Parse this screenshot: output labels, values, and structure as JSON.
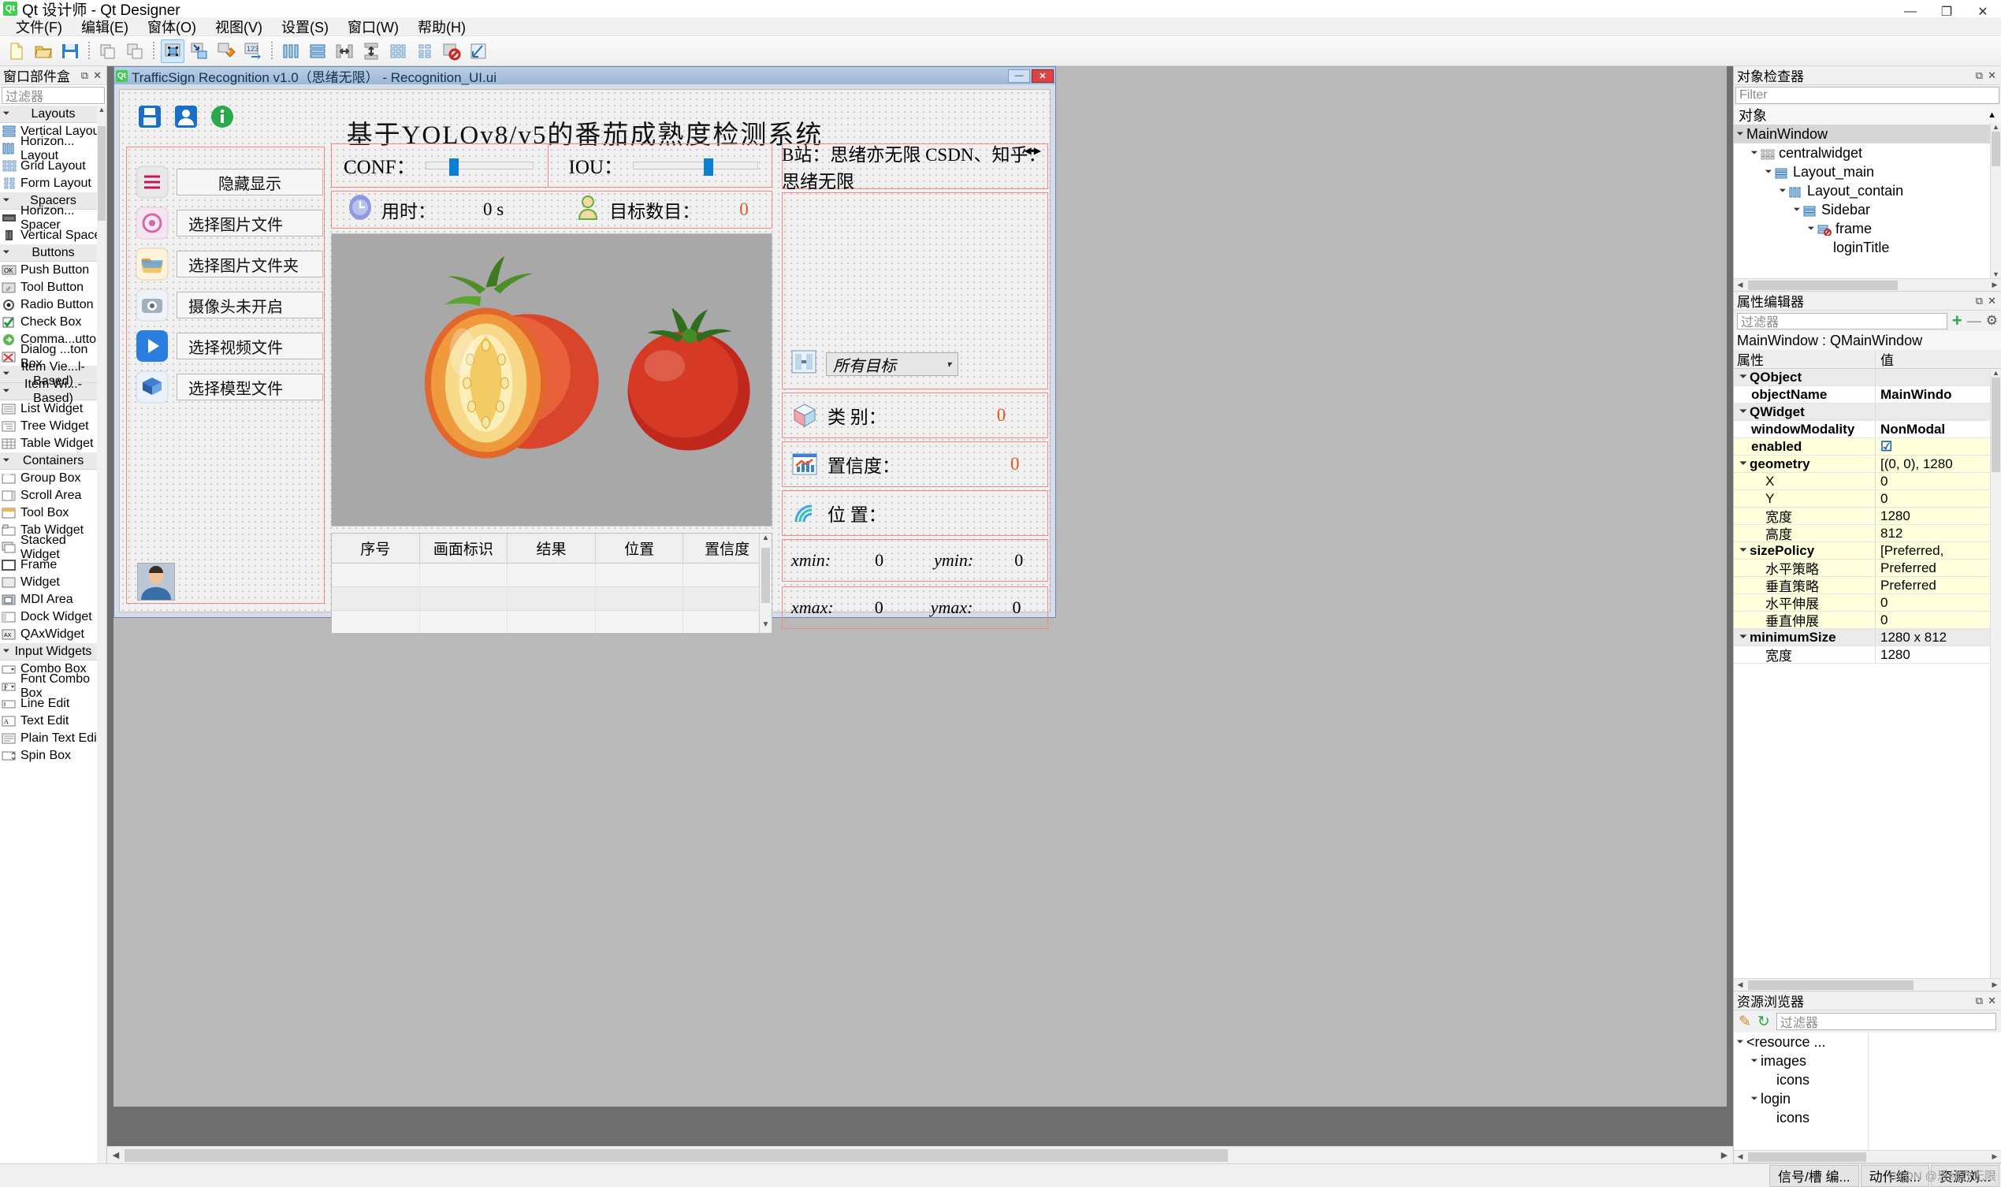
{
  "app": {
    "title": "Qt 设计师 - Qt Designer",
    "logo_text": "Qt",
    "win_buttons": {
      "minimize": "—",
      "maximize": "❐",
      "close": "✕"
    }
  },
  "menubar": {
    "items": [
      {
        "label": "文件(F)"
      },
      {
        "label": "编辑(E)"
      },
      {
        "label": "窗体(O)"
      },
      {
        "label": "视图(V)"
      },
      {
        "label": "设置(S)"
      },
      {
        "label": "窗口(W)"
      },
      {
        "label": "帮助(H)"
      }
    ]
  },
  "toolbar": {
    "buttons": [
      {
        "name": "new-form-icon"
      },
      {
        "name": "open-form-icon"
      },
      {
        "name": "save-form-icon"
      },
      {
        "name": "cut-icon"
      },
      {
        "name": "copy-icon"
      },
      {
        "name": "edit-widgets-icon",
        "active": true
      },
      {
        "name": "edit-signals-slots-icon"
      },
      {
        "name": "edit-buddies-icon"
      },
      {
        "name": "edit-tab-order-icon"
      },
      {
        "name": "layout-horizontally-icon"
      },
      {
        "name": "layout-vertically-icon"
      },
      {
        "name": "layout-splitter-h-icon"
      },
      {
        "name": "layout-splitter-v-icon"
      },
      {
        "name": "layout-grid-icon"
      },
      {
        "name": "layout-form-icon"
      },
      {
        "name": "break-layout-icon"
      },
      {
        "name": "adjust-size-icon"
      }
    ]
  },
  "widgetbox": {
    "title": "窗口部件盒",
    "filter_placeholder": "过滤器",
    "groups": [
      {
        "label": "Layouts",
        "items": [
          {
            "label": "Vertical Layout",
            "icon": "vertical-layout-icon"
          },
          {
            "label": "Horizon... Layout",
            "icon": "horizontal-layout-icon"
          },
          {
            "label": "Grid Layout",
            "icon": "grid-layout-icon"
          },
          {
            "label": "Form Layout",
            "icon": "form-layout-icon"
          }
        ]
      },
      {
        "label": "Spacers",
        "items": [
          {
            "label": "Horizon... Spacer",
            "icon": "horizontal-spacer-icon"
          },
          {
            "label": "Vertical Spacer",
            "icon": "vertical-spacer-icon"
          }
        ]
      },
      {
        "label": "Buttons",
        "items": [
          {
            "label": "Push Button",
            "icon": "push-button-icon"
          },
          {
            "label": "Tool Button",
            "icon": "tool-button-icon"
          },
          {
            "label": "Radio Button",
            "icon": "radio-button-icon"
          },
          {
            "label": "Check Box",
            "icon": "check-box-icon"
          },
          {
            "label": "Comma...utton",
            "icon": "command-link-button-icon"
          },
          {
            "label": "Dialog ...ton Box",
            "icon": "dialog-button-box-icon"
          }
        ]
      },
      {
        "label": "Item Vie...l-Based)",
        "items": []
      },
      {
        "label": "Item Wi...-Based)",
        "items": [
          {
            "label": "List Widget",
            "icon": "list-widget-icon"
          },
          {
            "label": "Tree Widget",
            "icon": "tree-widget-icon"
          },
          {
            "label": "Table Widget",
            "icon": "table-widget-icon"
          }
        ]
      },
      {
        "label": "Containers",
        "items": [
          {
            "label": "Group Box",
            "icon": "group-box-icon"
          },
          {
            "label": "Scroll Area",
            "icon": "scroll-area-icon"
          },
          {
            "label": "Tool Box",
            "icon": "tool-box-icon"
          },
          {
            "label": "Tab Widget",
            "icon": "tab-widget-icon"
          },
          {
            "label": "Stacked Widget",
            "icon": "stacked-widget-icon"
          },
          {
            "label": "Frame",
            "icon": "frame-icon"
          },
          {
            "label": "Widget",
            "icon": "widget-icon"
          },
          {
            "label": "MDI Area",
            "icon": "mdi-area-icon"
          },
          {
            "label": "Dock Widget",
            "icon": "dock-widget-icon"
          },
          {
            "label": "QAxWidget",
            "icon": "qax-widget-icon"
          }
        ]
      },
      {
        "label": "Input Widgets",
        "items": [
          {
            "label": "Combo Box",
            "icon": "combo-box-icon"
          },
          {
            "label": "Font Combo Box",
            "icon": "font-combo-box-icon"
          },
          {
            "label": "Line Edit",
            "icon": "line-edit-icon"
          },
          {
            "label": "Text Edit",
            "icon": "text-edit-icon"
          },
          {
            "label": "Plain Text Edit",
            "icon": "plain-text-edit-icon"
          },
          {
            "label": "Spin Box",
            "icon": "spin-box-icon"
          }
        ]
      }
    ]
  },
  "mdi_window": {
    "title": "TrafficSign Recognition v1.0（思绪无限） - Recognition_UI.ui",
    "logo_text": "Qt",
    "buttons": {
      "minimize": "—",
      "close": "✕"
    }
  },
  "form": {
    "app_title": "基于YOLOv8/v5的番茄成熟度检测系统",
    "top_icons": [
      {
        "name": "save-icon"
      },
      {
        "name": "user-icon"
      },
      {
        "name": "info-icon"
      }
    ],
    "sidebar": [
      {
        "icon": "menu-lines-icon",
        "label": "隐藏显示"
      },
      {
        "icon": "image-file-icon",
        "label": "选择图片文件"
      },
      {
        "icon": "folder-icon",
        "label": "选择图片文件夹"
      },
      {
        "icon": "camera-icon",
        "label": "摄像头未开启"
      },
      {
        "icon": "video-icon",
        "label": "选择视频文件"
      },
      {
        "icon": "model-icon",
        "label": "选择模型文件"
      }
    ],
    "avatar": {
      "name": "user-avatar"
    },
    "sliders": [
      {
        "label": "CONF：",
        "name": "conf-slider",
        "value_pct": 22
      },
      {
        "label": "IOU：",
        "name": "iou-slider",
        "value_pct": 57
      }
    ],
    "stats": [
      {
        "icon": "clock-icon",
        "label": "用时：",
        "value": "0 s"
      },
      {
        "icon": "people-icon",
        "label": "目标数目：",
        "value": "0"
      }
    ],
    "preview": {
      "name": "image-preview",
      "content": "tomato-image"
    },
    "table": {
      "headers": [
        "序号",
        "画面标识",
        "结果",
        "位置",
        "置信度"
      ],
      "rows": [
        [],
        [],
        [],
        []
      ]
    },
    "right_panel": {
      "credit": "B站：思绪亦无限  CSDN、知乎：思绪无限",
      "nav": {
        "prev": "◀",
        "next": "▶"
      },
      "target_selector": {
        "icon": "target-select-icon",
        "value": "所有目标"
      },
      "results": [
        {
          "icon": "class-cube-icon",
          "label": "类  别：",
          "value": "0"
        },
        {
          "icon": "confidence-chart-icon",
          "label": "置信度：",
          "value": "0"
        },
        {
          "icon": "location-signal-icon",
          "label": "位  置：",
          "value": ""
        }
      ],
      "coords": [
        {
          "label": "xmin:",
          "value": "0"
        },
        {
          "label": "ymin:",
          "value": "0"
        },
        {
          "label": "xmax:",
          "value": "0"
        },
        {
          "label": "ymax:",
          "value": "0"
        }
      ]
    }
  },
  "object_inspector": {
    "title": "对象检查器",
    "filter_placeholder": "Filter",
    "column_header": "对象",
    "tree": [
      {
        "label": "MainWindow",
        "depth": 0,
        "icon": "main-window-icon",
        "expanded": true,
        "selected": true
      },
      {
        "label": "centralwidget",
        "depth": 1,
        "icon": "grid-layout-icon",
        "expanded": true
      },
      {
        "label": "Layout_main",
        "depth": 2,
        "icon": "vertical-layout-icon",
        "expanded": true
      },
      {
        "label": "Layout_contain",
        "depth": 3,
        "icon": "horizontal-layout-icon",
        "expanded": true
      },
      {
        "label": "Sidebar",
        "depth": 4,
        "icon": "vertical-layout-icon",
        "expanded": true
      },
      {
        "label": "frame",
        "depth": 5,
        "icon": "frame-nolayout-icon",
        "expanded": true
      },
      {
        "label": "loginTitle",
        "depth": 6,
        "icon": "label-icon"
      }
    ]
  },
  "property_editor": {
    "title": "属性编辑器",
    "filter_placeholder": "过滤器",
    "add_button": "+",
    "remove_button": "—",
    "config_button": "⚙",
    "object_line": "MainWindow : QMainWindow",
    "col_key": "属性",
    "col_value": "值",
    "rows": [
      {
        "key": "QObject",
        "value": "",
        "type": "group",
        "depth": 0
      },
      {
        "key": "objectName",
        "value": "MainWindo",
        "type": "bold",
        "depth": 1
      },
      {
        "key": "QWidget",
        "value": "",
        "type": "group",
        "depth": 0
      },
      {
        "key": "windowModality",
        "value": "NonModal",
        "type": "bold",
        "depth": 1
      },
      {
        "key": "enabled",
        "value": "☑",
        "type": "bold-yellow",
        "depth": 1
      },
      {
        "key": "geometry",
        "value": "[(0, 0), 1280",
        "type": "group-yellow",
        "depth": 0
      },
      {
        "key": "X",
        "value": "0",
        "type": "yellow",
        "depth": 2
      },
      {
        "key": "Y",
        "value": "0",
        "type": "yellow",
        "depth": 2
      },
      {
        "key": "宽度",
        "value": "1280",
        "type": "yellow",
        "depth": 2
      },
      {
        "key": "高度",
        "value": "812",
        "type": "yellow",
        "depth": 2
      },
      {
        "key": "sizePolicy",
        "value": "[Preferred, ",
        "type": "group-yellow",
        "depth": 0
      },
      {
        "key": "水平策略",
        "value": "Preferred",
        "type": "yellow",
        "depth": 2
      },
      {
        "key": "垂直策略",
        "value": "Preferred",
        "type": "yellow",
        "depth": 2
      },
      {
        "key": "水平伸展",
        "value": "0",
        "type": "yellow",
        "depth": 2
      },
      {
        "key": "垂直伸展",
        "value": "0",
        "type": "yellow",
        "depth": 2
      },
      {
        "key": "minimumSize",
        "value": "1280 x 812",
        "type": "group",
        "depth": 0
      },
      {
        "key": "宽度",
        "value": "1280",
        "type": "plain",
        "depth": 2
      }
    ]
  },
  "resource_browser": {
    "title": "资源浏览器",
    "edit_button": "✎",
    "reload_button": "↻",
    "filter_placeholder": "过滤器",
    "tree": [
      {
        "label": "<resource ...",
        "depth": 0,
        "expanded": true
      },
      {
        "label": "images",
        "depth": 1,
        "expanded": true
      },
      {
        "label": "icons",
        "depth": 2
      },
      {
        "label": "login",
        "depth": 1,
        "expanded": true
      },
      {
        "label": "icons",
        "depth": 2
      }
    ]
  },
  "statusbar": {
    "tabs": [
      {
        "label": "信号/槽 编..."
      },
      {
        "label": "动作编..."
      },
      {
        "label": "资源浏..."
      }
    ],
    "watermark": "CSDN @思绪亦无限"
  }
}
